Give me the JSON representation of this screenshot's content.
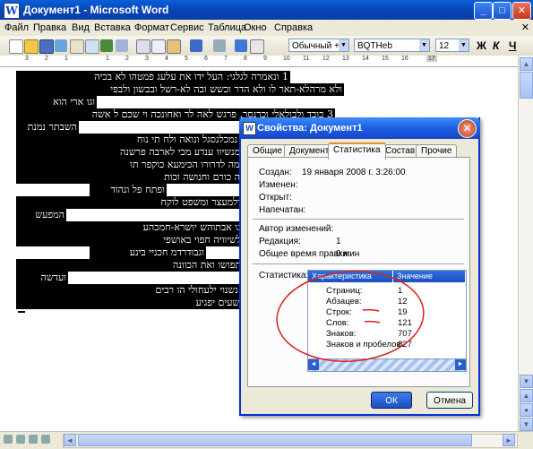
{
  "window": {
    "title": "Документ1 - Microsoft Word",
    "controls": [
      "_",
      "□",
      "✕"
    ]
  },
  "menu": {
    "items": [
      "Файл",
      "Правка",
      "Вид",
      "Вставка",
      "Формат",
      "Сервис",
      "Таблица",
      "Окно",
      "Справка"
    ],
    "close_doc": "✕"
  },
  "toolbar": {
    "style_combo": "Обычный + BQT",
    "font_combo": "BQTHeb",
    "size_combo": "12",
    "bold": "Ж",
    "italic": "К",
    "underline": "Ч"
  },
  "ruler": {
    "marks": [
      "3",
      "2",
      "1",
      "1",
      "2",
      "3",
      "4",
      "5",
      "6",
      "7",
      "8",
      "9",
      "10",
      "11",
      "12",
      "13",
      "14",
      "15",
      "16",
      "17"
    ]
  },
  "document": {
    "lines": [
      "1 ונאמרה לגלגי: העל ידו את עלעג פמטהו לא בכיה",
      "ולא מרהלא-תאר לו ולא הדר וכשש ובה לא-רשל ובבשון ולבפי",
      "וגו ארי הוא",
      "3 כובד ולבולאלי וכרנסר, פרגש לאה לר ואחונכה וי שכם ל אשה",
      "השבתר נמנת",
      "4 רכוי, רואף כולב ונואכ נמכלנסגל ונואה ולח תי נוח",
      "5 עלרמ הכי במאשנת ממנשיוו ענדע מכי לארבה פרשנה",
      "6 כלתרו כא עוזו נבט נחמה לדרורו הכימעא כוקפר תו",
      "7 נגו כו הואא ככי ימעשה כורם וחנושה וכות",
      "ופתח פל ונהוד",
      "8 אחתא ורדר מת ישו ידלמעצר ומשפט לוקח",
      "המפעש",
      "9 מבושלאשואקר לינו אגו אבתוהש יושרא-חמכהע",
      "10 עבדאלך אלתושם אלשיוויה חפוי באושפי",
      "וגבודרדמ חכניי בינע",
      "11 הביגבותונלוא ידעו לתפושו ואת הכוונה",
      "ועדשה",
      "12 אתל יולגונך לשלוכל נשנוי ילעחולי הו רבים",
      "והוא חטאה רבים נשא ולפשעים יפגיע"
    ]
  },
  "dialog": {
    "title": "Свойства: Документ1",
    "tabs": [
      "Общие",
      "Документ",
      "Статистика",
      "Состав",
      "Прочие"
    ],
    "active_tab": "Статистика",
    "fields": [
      {
        "label": "Создан:",
        "value": "19 января 2008 г. 3:26:00"
      },
      {
        "label": "Изменен:",
        "value": ""
      },
      {
        "label": "Открыт:",
        "value": ""
      },
      {
        "label": "Напечатан:",
        "value": ""
      }
    ],
    "fields2": [
      {
        "label": "Автор изменений:",
        "value": ""
      },
      {
        "label": "Редакция:",
        "value": "1"
      },
      {
        "label": "Общее время правки:",
        "value": "0 мин"
      }
    ],
    "stats_label": "Статистика:",
    "stats_header": [
      "Характеристика",
      "Значение"
    ],
    "stats": [
      {
        "name": "Страниц:",
        "value": "1"
      },
      {
        "name": "Абзацев:",
        "value": "12"
      },
      {
        "name": "Строк:",
        "value": "19"
      },
      {
        "name": "Слов:",
        "value": "121"
      },
      {
        "name": "Знаков:",
        "value": "707"
      },
      {
        "name": "Знаков и пробелов:",
        "value": "827"
      }
    ],
    "ok_label": "ОК",
    "cancel_label": "Отмена"
  }
}
